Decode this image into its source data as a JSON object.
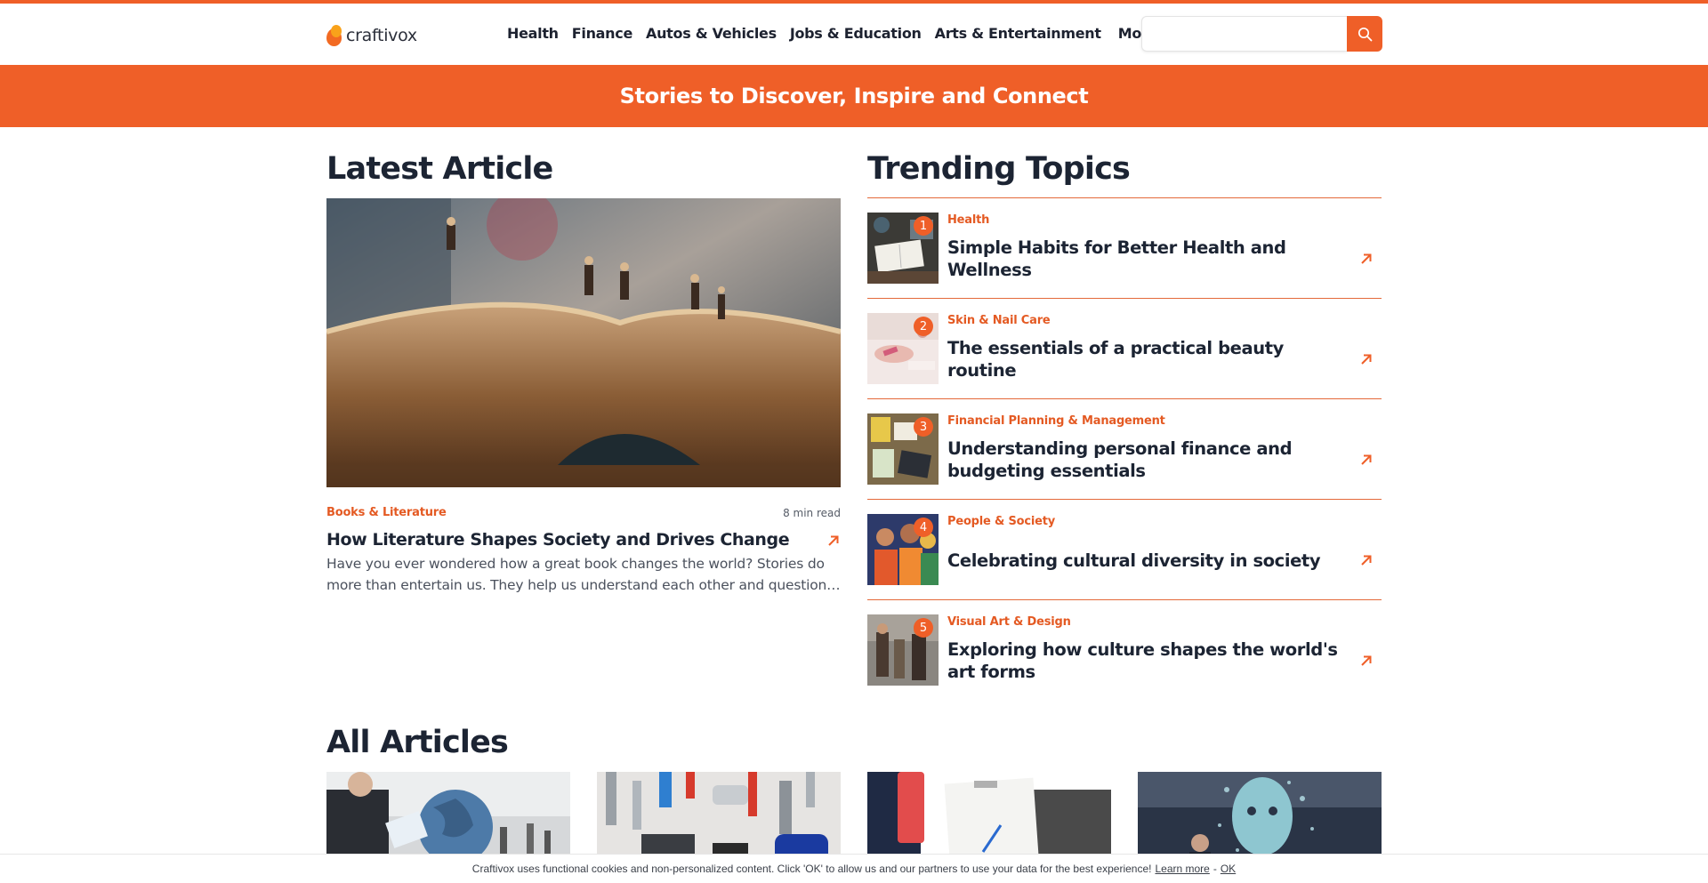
{
  "brand": {
    "name": "craftivox"
  },
  "nav": {
    "items": [
      "Health",
      "Finance",
      "Autos & Vehicles",
      "Jobs & Education",
      "Arts & Entertainment"
    ],
    "more_label": "More"
  },
  "search": {
    "placeholder": ""
  },
  "banner": {
    "text": "Stories to Discover, Inspire and Connect"
  },
  "latest": {
    "heading": "Latest Article",
    "category": "Books & Literature",
    "read_time": "8 min read",
    "title": "How Literature Shapes Society and Drives Change",
    "excerpt": "Have you ever wondered how a great book changes the world? Stories do more than entertain us. They help us understand each other and question the world around us."
  },
  "trending": {
    "heading": "Trending Topics",
    "items": [
      {
        "num": "1",
        "category": "Health",
        "title": "Simple Habits for Better Health and Wellness"
      },
      {
        "num": "2",
        "category": "Skin & Nail Care",
        "title": "The essentials of a practical beauty routine"
      },
      {
        "num": "3",
        "category": "Financial Planning & Management",
        "title": "Understanding personal finance and budgeting essentials"
      },
      {
        "num": "4",
        "category": "People & Society",
        "title": "Celebrating cultural diversity in society"
      },
      {
        "num": "5",
        "category": "Visual Art & Design",
        "title": "Exploring how culture shapes the world's art forms"
      }
    ]
  },
  "all_articles": {
    "heading": "All Articles"
  },
  "cookie": {
    "text": "Craftivox uses functional cookies and non-personalized content. Click 'OK' to allow us and our partners to use your data for the best experience!",
    "learn_more": "Learn more",
    "separator": "-",
    "ok": "OK"
  },
  "colors": {
    "accent": "#ef5f28",
    "text": "#1c2433"
  }
}
